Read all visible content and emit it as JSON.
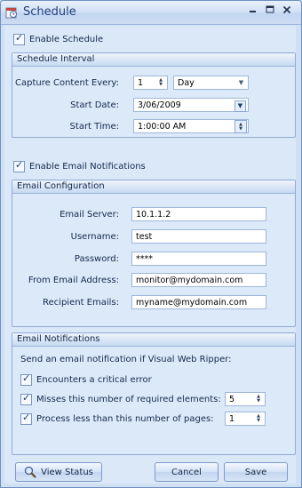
{
  "window": {
    "title": "Schedule"
  },
  "enable_schedule": {
    "label": "Enable Schedule",
    "checked": true
  },
  "schedule_interval": {
    "header": "Schedule Interval",
    "capture_label": "Capture Content Every:",
    "capture_value": "1",
    "capture_unit": "Day",
    "start_date_label": "Start Date:",
    "start_date_value": "3/06/2009",
    "start_time_label": "Start Time:",
    "start_time_value": "1:00:00 AM"
  },
  "enable_email": {
    "label": "Enable Email Notifications",
    "checked": true
  },
  "email_config": {
    "header": "Email Configuration",
    "server_label": "Email Server:",
    "server_value": "10.1.1.2",
    "username_label": "Username:",
    "username_value": "test",
    "password_label": "Password:",
    "password_value": "****",
    "from_label": "From Email Address:",
    "from_value": "monitor@mydomain.com",
    "recipients_label": "Recipient Emails:",
    "recipients_value": "myname@mydomain.com"
  },
  "email_notifications": {
    "header": "Email Notifications",
    "intro": "Send an email notification if Visual Web Ripper:",
    "critical_error": {
      "label": "Encounters a critical error",
      "checked": true
    },
    "missing_elements": {
      "label": "Misses this number of required elements:",
      "checked": true,
      "value": "5"
    },
    "few_pages": {
      "label": "Process less than this number of pages:",
      "checked": true,
      "value": "1"
    }
  },
  "buttons": {
    "view_status": "View Status",
    "cancel": "Cancel",
    "save": "Save"
  },
  "icons": {
    "app": "schedule-app-icon",
    "view_status": "magnifier-icon"
  }
}
